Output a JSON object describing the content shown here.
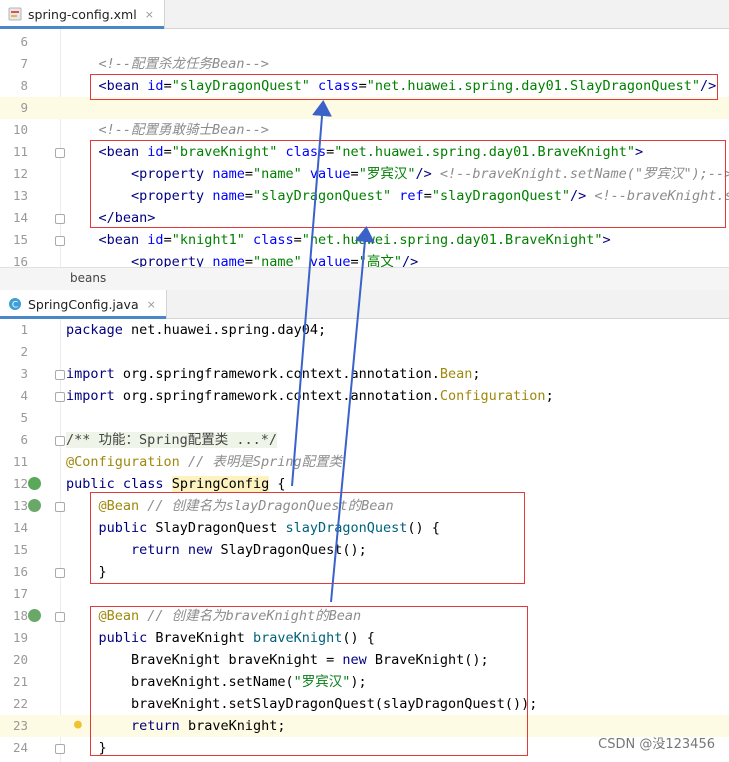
{
  "tab1": {
    "label": "spring-config.xml",
    "close": "×"
  },
  "xml_lines": [
    {
      "n": "6",
      "html": ""
    },
    {
      "n": "7",
      "html": "    <span class='c'>&lt;!--配置杀龙任务Bean--&gt;</span>"
    },
    {
      "n": "8",
      "html": "    <span class='t'>&lt;bean</span> <span class='a'>id</span>=<span class='v'>\"slayDragonQuest\"</span> <span class='a'>class</span>=<span class='v'>\"net.huawei.spring.day01.SlayDragonQuest\"</span><span class='t'>/&gt;</span>"
    },
    {
      "n": "9",
      "html": ""
    },
    {
      "n": "10",
      "html": "    <span class='c'>&lt;!--配置勇敢骑士Bean--&gt;</span>"
    },
    {
      "n": "11",
      "html": "    <span class='t'>&lt;bean</span> <span class='a'>id</span>=<span class='v'>\"braveKnight\"</span> <span class='a'>class</span>=<span class='v'>\"net.huawei.spring.day01.BraveKnight\"</span><span class='t'>&gt;</span>"
    },
    {
      "n": "12",
      "html": "        <span class='t'>&lt;property</span> <span class='a'>name</span>=<span class='v'>\"name\"</span> <span class='a'>value</span>=<span class='v'>\"罗宾汉\"</span><span class='t'>/&gt;</span> <span class='c'>&lt;!--braveKnight.setName(\"罗宾汉\");--&gt;</span>"
    },
    {
      "n": "13",
      "html": "        <span class='t'>&lt;property</span> <span class='a'>name</span>=<span class='v'>\"slayDragonQuest\"</span> <span class='a'>ref</span>=<span class='v'>\"slayDragonQuest\"</span><span class='t'>/&gt;</span> <span class='c'>&lt;!--braveKnight.se</span>"
    },
    {
      "n": "14",
      "html": "    <span class='t'>&lt;/bean&gt;</span>"
    },
    {
      "n": "15",
      "html": "    <span class='t'>&lt;bean</span> <span class='a'>id</span>=<span class='v'>\"knight1\"</span> <span class='a'>class</span>=<span class='v'>\"net.huawei.spring.day01.BraveKnight\"</span><span class='t'>&gt;</span>"
    },
    {
      "n": "16",
      "html": "        <span class='t'>&lt;property</span> <span class='a'>name</span>=<span class='v'>\"name\"</span> <span class='a'>value</span>=<span class='v'>\"高文\"</span><span class='t'>/&gt;</span>"
    }
  ],
  "breadcrumb": "beans",
  "tab2": {
    "label": "SpringConfig.java",
    "close": "×"
  },
  "java_lines": [
    {
      "n": "1",
      "html": "<span class='k'>package</span> net.huawei.spring.day04;"
    },
    {
      "n": "2",
      "html": ""
    },
    {
      "n": "3",
      "html": "<span class='k'>import</span> org.springframework.context.annotation.<span class='ty'>Bean</span>;"
    },
    {
      "n": "4",
      "html": "<span class='k'>import</span> org.springframework.context.annotation.<span class='ty'>Configuration</span>;"
    },
    {
      "n": "5",
      "html": ""
    },
    {
      "n": "6",
      "html": "<span class='c' style='font-style:normal;background:#eef4e8;color:#444'>/** 功能：Spring配置类 ...*/</span>"
    },
    {
      "n": "11",
      "html": "<span class='an'>@Configuration</span> <span class='c'>// 表明是Spring配置类</span>"
    },
    {
      "n": "12",
      "html": "<span class='k'>public class</span> <span class='cls'>SpringConfig</span> {"
    },
    {
      "n": "13",
      "html": "    <span class='an'>@Bean</span> <span class='c'>// 创建名为slayDragonQuest的Bean</span>"
    },
    {
      "n": "14",
      "html": "    <span class='k'>public</span> SlayDragonQuest <span class='m'>slayDragonQuest</span>() {"
    },
    {
      "n": "15",
      "html": "        <span class='k'>return new</span> SlayDragonQuest();"
    },
    {
      "n": "16",
      "html": "    }"
    },
    {
      "n": "17",
      "html": ""
    },
    {
      "n": "18",
      "html": "    <span class='an'>@Bean</span> <span class='c'>// 创建名为braveKnight的Bean</span>"
    },
    {
      "n": "19",
      "html": "    <span class='k'>public</span> BraveKnight <span class='m'>braveKnight</span>() {"
    },
    {
      "n": "20",
      "html": "        BraveKnight braveKnight = <span class='k'>new</span> BraveKnight();"
    },
    {
      "n": "21",
      "html": "        braveKnight.setName(<span class='s'>\"罗宾汉\"</span>);"
    },
    {
      "n": "22",
      "html": "        braveKnight.setSlayDragonQuest(slayDragonQuest());"
    },
    {
      "n": "23",
      "html": "        <span class='k'>return</span> braveKnight;"
    },
    {
      "n": "24",
      "html": "    }"
    }
  ],
  "watermark": "CSDN @没123456",
  "colors": {
    "annotation_box": "#e23a3a",
    "arrow": "#3b62c9"
  }
}
